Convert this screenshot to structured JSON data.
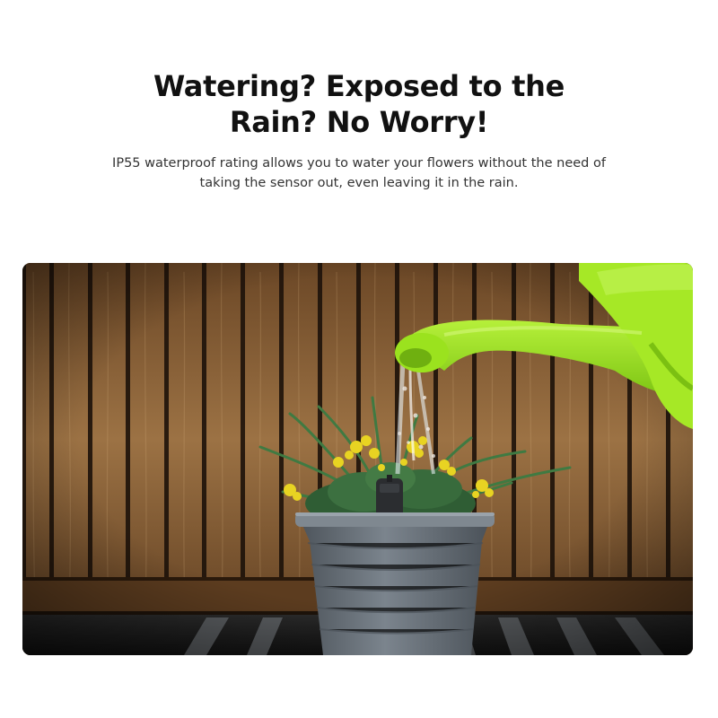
{
  "headline": {
    "line1": "Watering? Exposed to the",
    "line2": "Rain? No Worry!"
  },
  "description": {
    "line1": "IP55 waterproof rating allows you to water your flowers without the need of",
    "line2": "taking the sensor out, even leaving it in the rain."
  },
  "colors": {
    "watering_can": "#9be21e",
    "wood": "#8a6136",
    "pot": "#6f7780",
    "flowers": "#e8d322"
  }
}
